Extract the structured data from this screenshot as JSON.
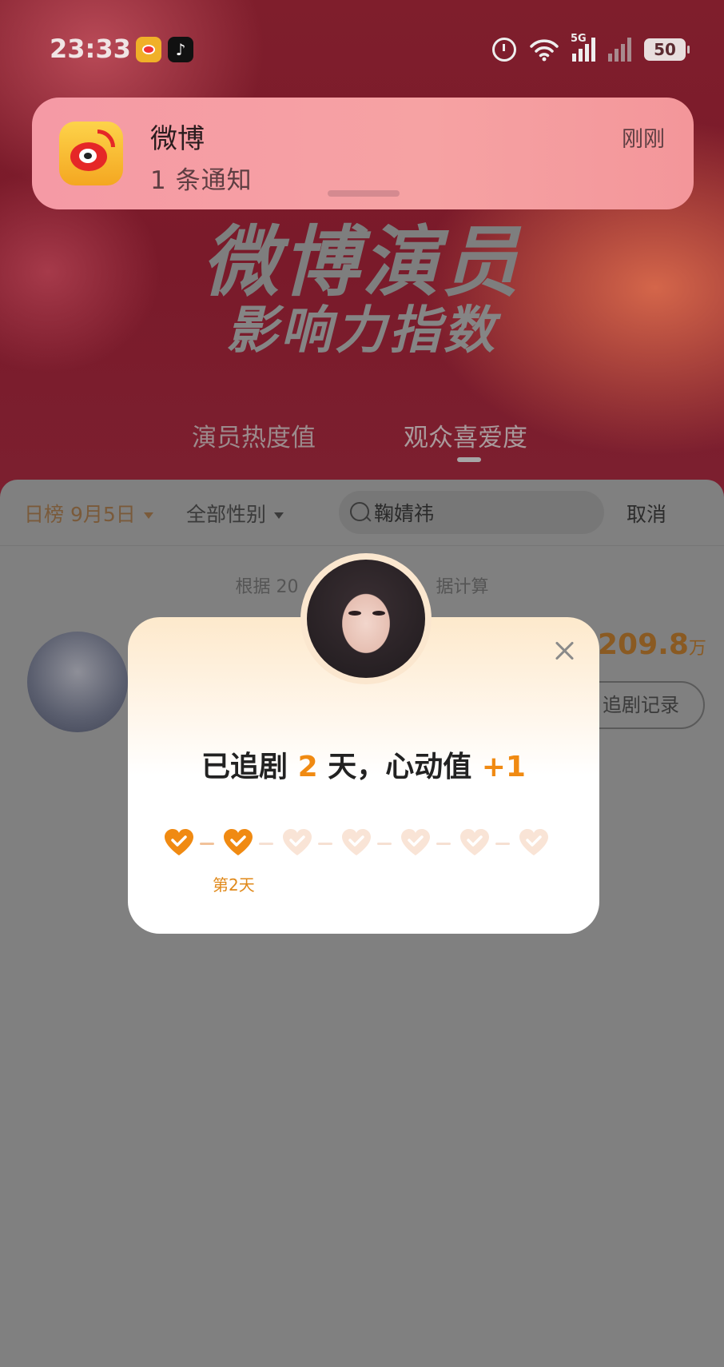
{
  "status_bar": {
    "time": "23:33",
    "network": "5G",
    "battery": "50"
  },
  "hero": {
    "title": "微博演员",
    "subtitle": "影响力指数",
    "tabs": [
      {
        "label": "演员热度值"
      },
      {
        "label": "观众喜爱度"
      }
    ]
  },
  "notification": {
    "app_name": "微博",
    "message": "1 条通知",
    "time": "刚刚"
  },
  "filters": {
    "date": "日榜 9月5日",
    "gender": "全部性别",
    "search_value": "鞠婧祎",
    "cancel": "取消"
  },
  "list": {
    "basis_text": "根据 20",
    "basis_text_end": "据计算",
    "row": {
      "score": "209.8",
      "score_unit": "万",
      "action": "追剧记录"
    }
  },
  "modal": {
    "headline_prefix": "已追剧",
    "days": "2",
    "headline_mid": "天，心动值",
    "bonus": "+1",
    "hearts": [
      {
        "state": "checked"
      },
      {
        "state": "checked"
      },
      {
        "state": "empty"
      },
      {
        "state": "empty"
      },
      {
        "state": "empty"
      },
      {
        "state": "empty"
      },
      {
        "state": "empty"
      }
    ],
    "current_day_label": "第2天"
  },
  "colors": {
    "accent": "#f08a12",
    "heart_on": "#f08a12",
    "heart_off": "#f9e4d6"
  }
}
